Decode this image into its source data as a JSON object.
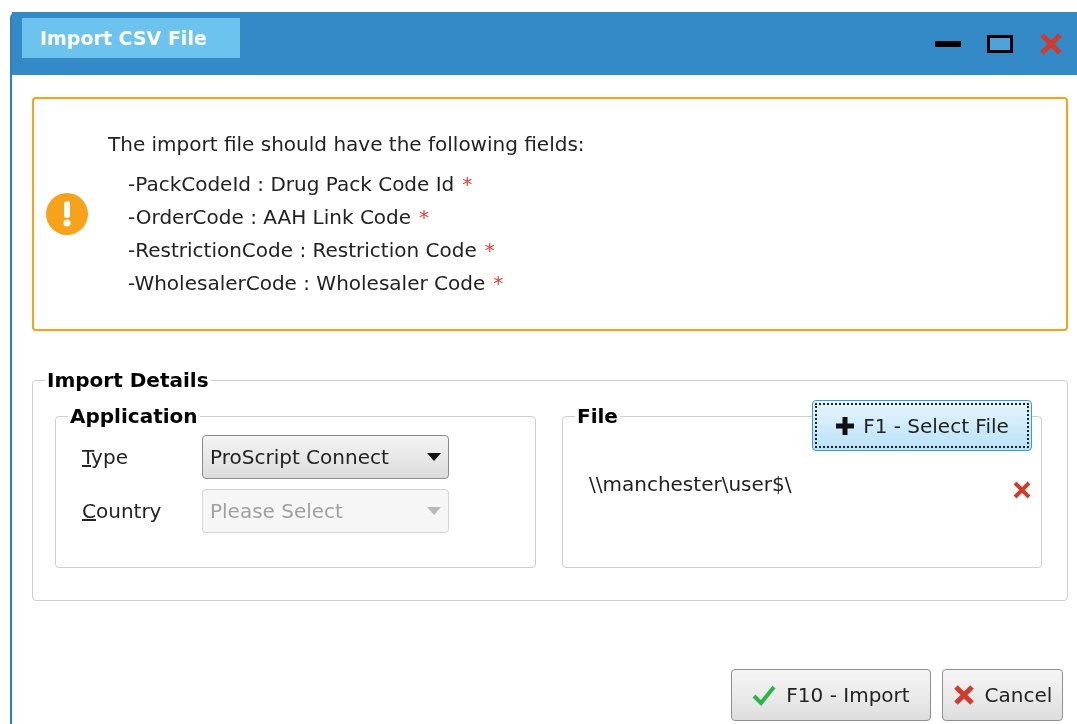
{
  "window": {
    "title": "Import CSV File"
  },
  "notice": {
    "heading": "The import file should have the following fields:",
    "fields": [
      {
        "text": "-PackCodeId : Drug Pack Code Id",
        "marker": "*"
      },
      {
        "text": "-OrderCode : AAH Link Code",
        "marker": "*"
      },
      {
        "text": "-RestrictionCode : Restriction Code",
        "marker": "*"
      },
      {
        "text": "-WholesalerCode : Wholesaler Code",
        "marker": "*"
      }
    ]
  },
  "import_details": {
    "title": "Import Details",
    "application": {
      "title": "Application",
      "rows": [
        {
          "label": "Type",
          "value": "ProScript Connect",
          "disabled": false
        },
        {
          "label": "Country",
          "value": "Please Select",
          "disabled": true
        }
      ]
    },
    "file": {
      "title": "File",
      "path": "\\\\manchester\\user$\\",
      "select_button": {
        "label": "F1 - Select File",
        "focused": true
      }
    }
  },
  "buttons": [
    {
      "kind": "import",
      "label": "F10 - Import"
    },
    {
      "kind": "cancel",
      "label": "Cancel"
    }
  ]
}
